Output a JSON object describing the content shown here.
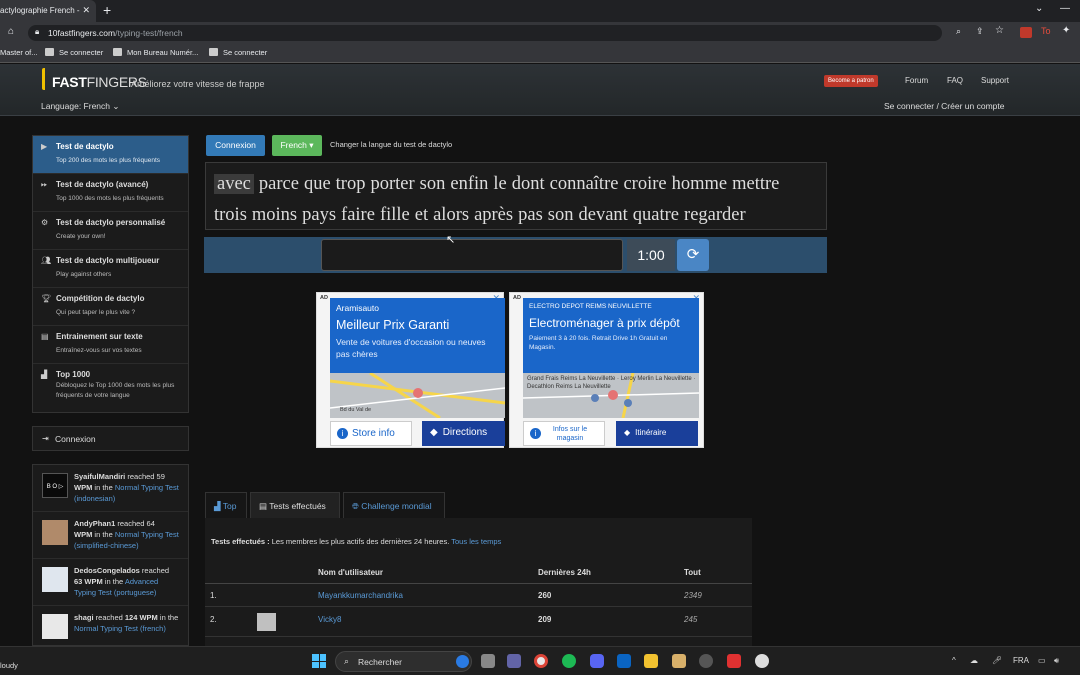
{
  "browser": {
    "tab_title": "actylographie French -",
    "url_host": "10fastfingers.com",
    "url_path": "/typing-test/french",
    "bookmarks": [
      "Master of...",
      "Se connecter",
      "Mon Bureau Numér...",
      "Se connecter"
    ]
  },
  "site": {
    "logo_prefix": "FAST",
    "logo_suffix": "FINGERS",
    "tagline": "Améliorez votre vitesse de frappe",
    "language": "Language: French",
    "patron": "Become a patron",
    "nav": [
      "Forum",
      "FAQ",
      "Support"
    ],
    "login": "Se connecter / Créer un compte"
  },
  "sidebar": {
    "items": [
      {
        "title": "Test de dactylo",
        "sub": "Top 200 des mots les plus fréquents",
        "icon": "play-icon"
      },
      {
        "title": "Test de dactylo (avancé)",
        "sub": "Top 1000 des mots les plus fréquents",
        "icon": "fast-forward-icon"
      },
      {
        "title": "Test de dactylo personnalisé",
        "sub": "Create your own!",
        "icon": "cogs-icon"
      },
      {
        "title": "Test de dactylo multijoueur",
        "sub": "Play against others",
        "icon": "users-icon"
      },
      {
        "title": "Compétition de dactylo",
        "sub": "Qui peut taper le plus vite ?",
        "icon": "trophy-icon"
      },
      {
        "title": "Entrainement sur texte",
        "sub": "Entraînez-vous sur vos textes",
        "icon": "file-icon"
      },
      {
        "title": "Top 1000",
        "sub": "Débloquez le Top 1000 des mots les plus fréquents de votre langue",
        "icon": "bar-chart-icon"
      }
    ],
    "connexion": "Connexion",
    "feed": [
      {
        "user": "SyaifulMandiri",
        "a": " reached 59",
        "b": "WPM",
        "c": " in the ",
        "test": "Normal Typing Test (indonesian)"
      },
      {
        "user": "AndyPhan1",
        "a": " reached 64",
        "b": "WPM",
        "c": " in the ",
        "test": "Normal Typing Test (simplified-chinese)"
      },
      {
        "user": "DedosCongelados",
        "a": " reached",
        "b": "63 WPM",
        "c": " in the ",
        "test": "Advanced Typing Test (portuguese)"
      },
      {
        "user": "shagi",
        "a": " reached ",
        "b": "124 WPM",
        "c": " in the ",
        "test": "Normal Typing Test (french)"
      }
    ]
  },
  "main": {
    "connexion_btn": "Connexion",
    "lang_btn": "French ▾",
    "change_lang": "Changer la langue du test de dactylo",
    "words_line1": [
      "avec",
      "parce",
      "que",
      "trop",
      "porter",
      "son",
      "enfin",
      "le",
      "dont",
      "connaître",
      "croire",
      "homme",
      "mettre"
    ],
    "words_line2": [
      "trois",
      "moins",
      "pays",
      "faire",
      "fille",
      "et",
      "alors",
      "après",
      "pas",
      "son",
      "devant",
      "quatre",
      "regarder"
    ],
    "timer": "1:00"
  },
  "ads": [
    {
      "tag": "AD",
      "brand": "Aramisauto",
      "headline": "Meilleur Prix Garanti",
      "body": "Vente de voitures d'occasion ou neuves pas chères",
      "btn1": "Store info",
      "btn2": "Directions",
      "map_label": "Bd du Val de"
    },
    {
      "tag": "AD",
      "brand": "ELECTRO DEPOT REIMS NEUVILLETTE",
      "headline": "Electroménager à prix dépôt",
      "body": "Paiement 3 à 20 fois. Retrait Drive 1h Gratuit en Magasin.",
      "btn1": "Infos sur le magasin",
      "btn2": "Itinéraire",
      "map_label": "Grand Frais Reims La Neuvillette · Leroy Merlin La Neuvillette · Decathlon Reims La Neuvillette"
    }
  ],
  "leaderboard": {
    "tabs": [
      "Top",
      "Tests effectués",
      "Challenge mondial"
    ],
    "desc_bold": "Tests effectués :",
    "desc": " Les membres les plus actifs des dernières 24 heures. ",
    "desc_link": "Tous les temps",
    "headers": [
      "Nom d'utilisateur",
      "Dernières 24h",
      "Tout"
    ],
    "rows": [
      {
        "rank": "1.",
        "name": "Mayankkumarchandrika",
        "day": "260",
        "all": "2349"
      },
      {
        "rank": "2.",
        "name": "Vicky8",
        "day": "209",
        "all": "245"
      }
    ]
  },
  "taskbar": {
    "weather": "loudy",
    "search": "Rechercher",
    "lang": "FRA"
  },
  "colors": {
    "accent": "#337ab7",
    "green": "#5cb85c",
    "active_nav": "#2c5d8a",
    "link": "#5a9ad6"
  }
}
